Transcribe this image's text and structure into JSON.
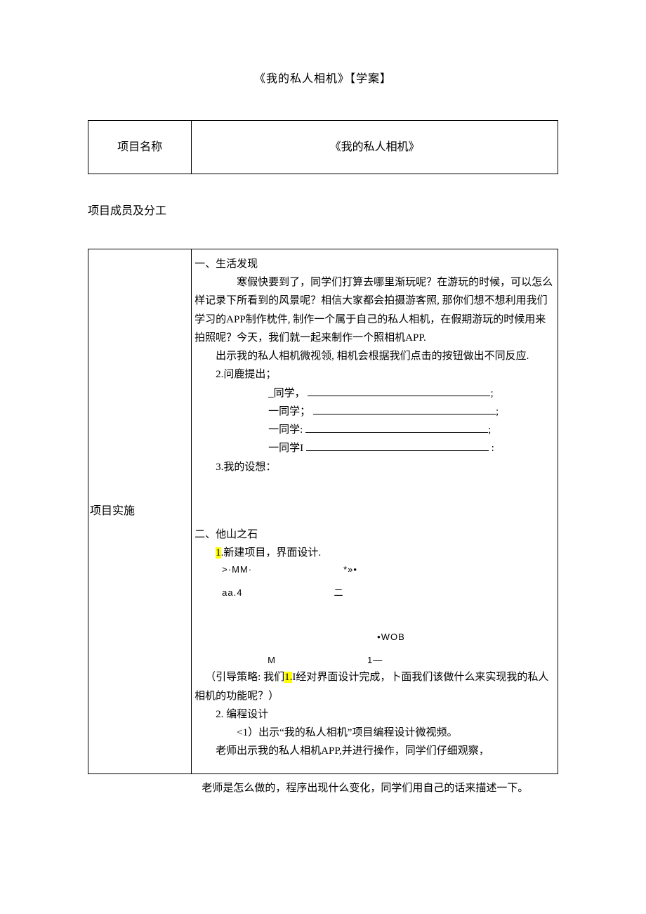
{
  "title": "《我的私人相机》【学案】",
  "table1": {
    "label": "项目名称",
    "value": "《我的私人相机》"
  },
  "subheading": "项目成员及分工",
  "leftcol": "项目实施",
  "sec1": {
    "heading": "一、生活发现",
    "p1": "寒假快要到了，同学们打算去哪里渐玩呢？在游玩的时候，可以怎么样记录下所看到的风景呢？相信大家都会拍摄游客照, 那你们想不想利用我们学习的APP制作枕件, 制作一个属于自己的私人相机，在假期游玩的时候用来拍照呢？今天，我们就一起来制作一个照相机APP.",
    "p2": "出示我的私人相机微视领, 相机会根据我们点击的按钮做出不同反应.",
    "q_heading": "2.问鹿提出；",
    "q1": "_同学，",
    "q2": "一同学；",
    "q3": "一同学:",
    "q4": "一同学I",
    "idea": "3.我的设想："
  },
  "sec2": {
    "heading": "二、他山之石",
    "step1_num": "1",
    "step1": ".新建项目，界面设计.",
    "row1a": ">·MM·",
    "row1b": "*»•",
    "row2a": "aa.4",
    "row2b": "二",
    "row3a": "",
    "row3b": "•WOB",
    "row4a": "M",
    "row4b": "1—",
    "guide_pre": "（引导策略: 我们",
    "guide_hl": "1.",
    "guide_post": "I经对界面设计完成，卜面我们该做什么来实现我的私人相机的功能呢？）",
    "step2": "2. 编程设计",
    "step2_1": "<1）出示“我的私人相机”项目编程设计微视频。",
    "step2_2": "老师出示我的私人相机APP,并进行操作，同学们仔细观察，"
  },
  "outside": "老师是怎么做的，程序出现什么变化，同学们用自己的话来描述一下。"
}
